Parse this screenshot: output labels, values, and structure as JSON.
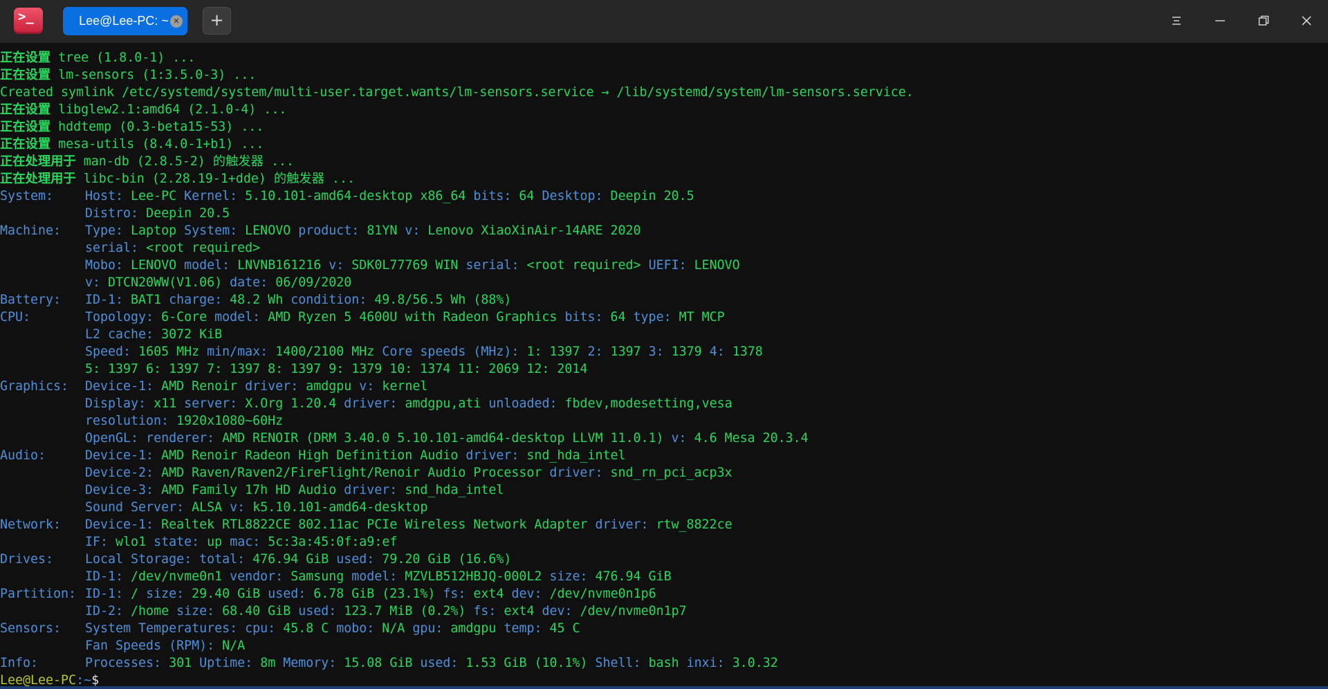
{
  "window": {
    "tab_title": "Lee@Lee-PC: ~",
    "tab_close_icon": "close-icon",
    "add_tab_label": "+",
    "app_icon_glyph": ">_"
  },
  "terminal": {
    "install_lines": [
      {
        "prefix": "正在设置 ",
        "text": "tree (1.8.0-1) ..."
      },
      {
        "prefix": "正在设置 ",
        "text": "lm-sensors (1:3.5.0-3) ..."
      },
      {
        "prefix": "",
        "text": "Created symlink /etc/systemd/system/multi-user.target.wants/lm-sensors.service → /lib/systemd/system/lm-sensors.service."
      },
      {
        "prefix": "正在设置 ",
        "text": "libglew2.1:amd64 (2.1.0-4) ..."
      },
      {
        "prefix": "正在设置 ",
        "text": "hddtemp (0.3-beta15-53) ..."
      },
      {
        "prefix": "正在设置 ",
        "text": "mesa-utils (8.4.0-1+b1) ..."
      },
      {
        "prefix": "正在处理用于 ",
        "text": "man-db (2.8.5-2) 的触发器 ..."
      },
      {
        "prefix": "正在处理用于 ",
        "text": "libc-bin (2.28.19-1+dde) 的触发器 ..."
      }
    ],
    "inxi_lines": [
      {
        "label": "System:",
        "parts": [
          [
            "Host:",
            "Lee-PC"
          ],
          [
            "Kernel:",
            "5.10.101-amd64-desktop x86_64"
          ],
          [
            "bits:",
            "64"
          ],
          [
            "Desktop:",
            "Deepin 20.5"
          ]
        ]
      },
      {
        "label": "",
        "parts": [
          [
            "Distro:",
            "Deepin 20.5"
          ]
        ]
      },
      {
        "label": "Machine:",
        "parts": [
          [
            "Type:",
            "Laptop"
          ],
          [
            "System:",
            "LENOVO"
          ],
          [
            "product:",
            "81YN"
          ],
          [
            "v:",
            "Lenovo XiaoXinAir-14ARE 2020"
          ]
        ]
      },
      {
        "label": "",
        "parts": [
          [
            "serial:",
            "<root required>"
          ]
        ]
      },
      {
        "label": "",
        "parts": [
          [
            "Mobo:",
            "LENOVO"
          ],
          [
            "model:",
            "LNVNB161216"
          ],
          [
            "v:",
            "SDK0L77769 WIN"
          ],
          [
            "serial:",
            "<root required>"
          ],
          [
            "UEFI:",
            "LENOVO"
          ]
        ]
      },
      {
        "label": "",
        "parts": [
          [
            "v:",
            "DTCN20WW(V1.06)"
          ],
          [
            "date:",
            "06/09/2020"
          ]
        ]
      },
      {
        "label": "Battery:",
        "parts": [
          [
            "ID-1:",
            "BAT1"
          ],
          [
            "charge:",
            "48.2 Wh"
          ],
          [
            "condition:",
            "49.8/56.5 Wh (88%)"
          ]
        ]
      },
      {
        "label": "CPU:",
        "parts": [
          [
            "Topology:",
            "6-Core"
          ],
          [
            "model:",
            "AMD Ryzen 5 4600U with Radeon Graphics"
          ],
          [
            "bits:",
            "64"
          ],
          [
            "type:",
            "MT MCP"
          ]
        ]
      },
      {
        "label": "",
        "parts": [
          [
            "L2 cache:",
            "3072 KiB"
          ]
        ]
      },
      {
        "label": "",
        "parts": [
          [
            "Speed:",
            "1605 MHz"
          ],
          [
            "min/max:",
            "1400/2100 MHz"
          ],
          [
            "Core speeds (MHz):",
            "1:"
          ],
          [
            "",
            "1397"
          ],
          [
            "2:",
            "1397"
          ],
          [
            "3:",
            "1379"
          ],
          [
            "4:",
            "1378"
          ]
        ]
      },
      {
        "label": "",
        "parts": [
          [
            "",
            "5: 1397 6: 1397 7: 1397 8: 1397 9: 1379 10: 1374 11: 2069 12: 2014"
          ]
        ]
      },
      {
        "label": "Graphics:",
        "parts": [
          [
            "Device-1:",
            "AMD Renoir"
          ],
          [
            "driver:",
            "amdgpu"
          ],
          [
            "v:",
            "kernel"
          ]
        ]
      },
      {
        "label": "",
        "parts": [
          [
            "Display:",
            "x11"
          ],
          [
            "server:",
            "X.Org 1.20.4"
          ],
          [
            "driver:",
            "amdgpu,ati"
          ],
          [
            "unloaded:",
            "fbdev,modesetting,vesa"
          ]
        ]
      },
      {
        "label": "",
        "parts": [
          [
            "resolution:",
            "1920x1080~60Hz"
          ]
        ]
      },
      {
        "label": "",
        "parts": [
          [
            "OpenGL:",
            ""
          ],
          [
            "renderer:",
            "AMD RENOIR (DRM 3.40.0 5.10.101-amd64-desktop LLVM 11.0.1)"
          ],
          [
            "v:",
            "4.6 Mesa 20.3.4"
          ]
        ]
      },
      {
        "label": "Audio:",
        "parts": [
          [
            "Device-1:",
            "AMD Renoir Radeon High Definition Audio"
          ],
          [
            "driver:",
            "snd_hda_intel"
          ]
        ]
      },
      {
        "label": "",
        "parts": [
          [
            "Device-2:",
            "AMD Raven/Raven2/FireFlight/Renoir Audio Processor"
          ],
          [
            "driver:",
            "snd_rn_pci_acp3x"
          ]
        ]
      },
      {
        "label": "",
        "parts": [
          [
            "Device-3:",
            "AMD Family 17h HD Audio"
          ],
          [
            "driver:",
            "snd_hda_intel"
          ]
        ]
      },
      {
        "label": "",
        "parts": [
          [
            "Sound Server:",
            "ALSA"
          ],
          [
            "v:",
            "k5.10.101-amd64-desktop"
          ]
        ]
      },
      {
        "label": "Network:",
        "parts": [
          [
            "Device-1:",
            "Realtek RTL8822CE 802.11ac PCIe Wireless Network Adapter"
          ],
          [
            "driver:",
            "rtw_8822ce"
          ]
        ]
      },
      {
        "label": "",
        "parts": [
          [
            "IF:",
            "wlo1"
          ],
          [
            "state:",
            "up"
          ],
          [
            "mac:",
            "5c:3a:45:0f:a9:ef"
          ]
        ]
      },
      {
        "label": "Drives:",
        "parts": [
          [
            "Local Storage:",
            ""
          ],
          [
            "total:",
            "476.94 GiB"
          ],
          [
            "used:",
            "79.20 GiB (16.6%)"
          ]
        ]
      },
      {
        "label": "",
        "parts": [
          [
            "ID-1:",
            "/dev/nvme0n1"
          ],
          [
            "vendor:",
            "Samsung"
          ],
          [
            "model:",
            "MZVLB512HBJQ-000L2"
          ],
          [
            "size:",
            "476.94 GiB"
          ]
        ]
      },
      {
        "label": "Partition:",
        "parts": [
          [
            "ID-1:",
            "/"
          ],
          [
            "size:",
            "29.40 GiB"
          ],
          [
            "used:",
            "6.78 GiB (23.1%)"
          ],
          [
            "fs:",
            "ext4"
          ],
          [
            "dev:",
            "/dev/nvme0n1p6"
          ]
        ]
      },
      {
        "label": "",
        "parts": [
          [
            "ID-2:",
            "/home"
          ],
          [
            "size:",
            "68.40 GiB"
          ],
          [
            "used:",
            "123.7 MiB (0.2%)"
          ],
          [
            "fs:",
            "ext4"
          ],
          [
            "dev:",
            "/dev/nvme0n1p7"
          ]
        ]
      },
      {
        "label": "Sensors:",
        "parts": [
          [
            "System Temperatures:",
            ""
          ],
          [
            "cpu:",
            "45.8 C"
          ],
          [
            "mobo:",
            "N/A"
          ],
          [
            "gpu:",
            "amdgpu"
          ],
          [
            "temp:",
            "45 C"
          ]
        ]
      },
      {
        "label": "",
        "parts": [
          [
            "Fan Speeds (RPM):",
            "N/A"
          ]
        ]
      },
      {
        "label": "Info:",
        "parts": [
          [
            "Processes:",
            "301"
          ],
          [
            "Uptime:",
            "8m"
          ],
          [
            "Memory:",
            "15.08 GiB"
          ],
          [
            "used:",
            "1.53 GiB (10.1%)"
          ],
          [
            "Shell:",
            "bash"
          ],
          [
            "inxi:",
            "3.0.32"
          ]
        ]
      }
    ],
    "prompt": {
      "user_host": "Lee@Lee-PC",
      "path": ":~",
      "symbol": "$"
    }
  },
  "colors": {
    "titlebar_bg": "#262626",
    "terminal_bg": "#101010",
    "green": "#28d75c",
    "blue": "#4f8fdc",
    "tab_active": "#0a6fe0",
    "prompt_user": "#b6c630",
    "prompt_path": "#4f8fdc"
  },
  "icons": {
    "menu": "menu-icon",
    "minimize": "minimize-icon",
    "restore": "restore-icon",
    "close": "close-icon"
  }
}
